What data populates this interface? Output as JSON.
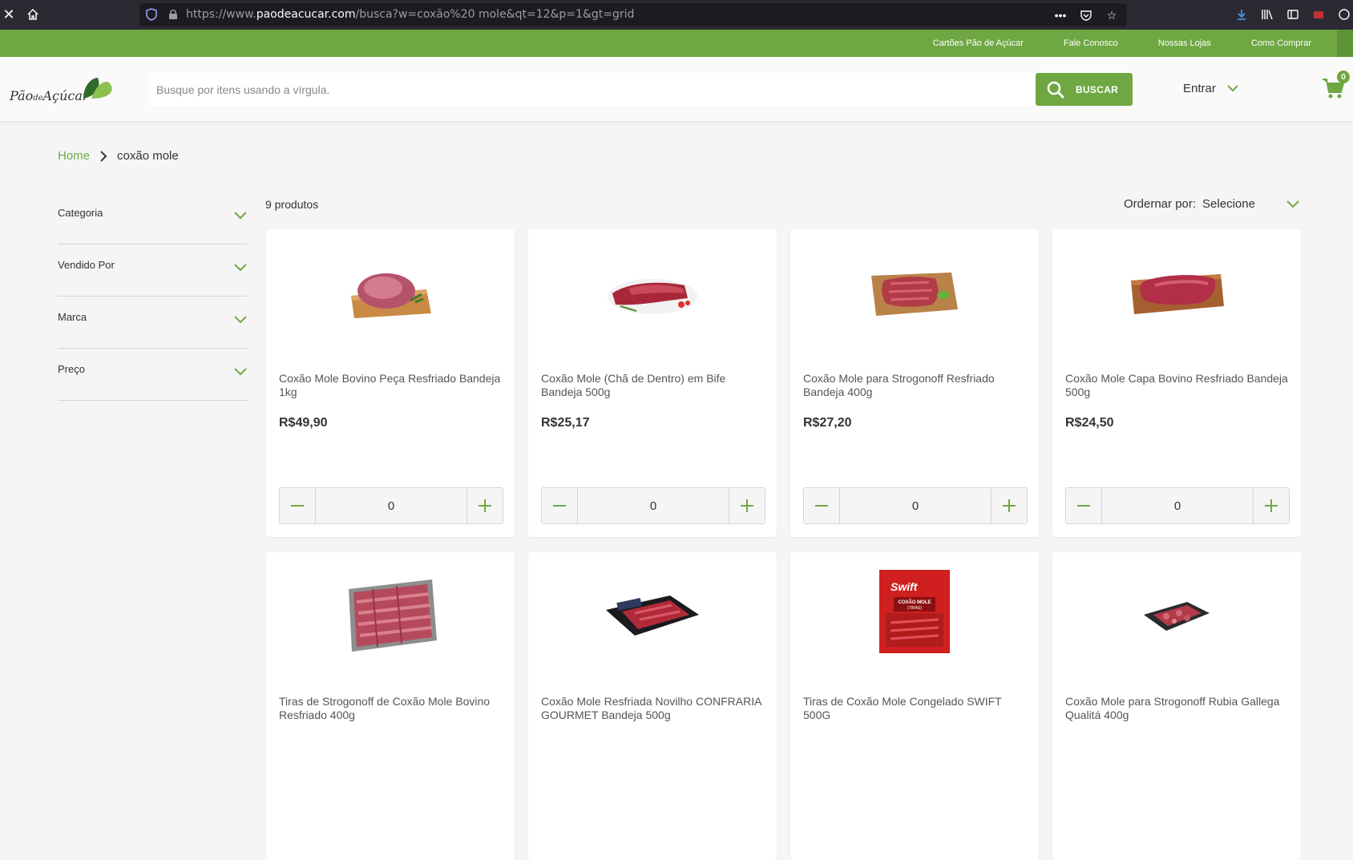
{
  "browser": {
    "url_prefix": "https://www.",
    "url_domain": "paodeacucar.com",
    "url_path": "/busca?w=coxão%20 mole&qt=12&p=1&gt=grid"
  },
  "topbar": {
    "links": [
      "Cartões Pão de Açúcar",
      "Fale Conosco",
      "Nossas Lojas",
      "Como Comprar"
    ]
  },
  "header": {
    "logo_main": "Pão",
    "logo_de": "de",
    "logo_end": "Açúcar",
    "search_placeholder": "Busque por itens usando a vírgula.",
    "search_button": "BUSCAR",
    "login_label": "Entrar",
    "cart_count": "0"
  },
  "breadcrumb": {
    "home": "Home",
    "current": "coxão mole"
  },
  "filters": [
    "Categoria",
    "Vendido Por",
    "Marca",
    "Preço"
  ],
  "results": {
    "count": "9 produtos",
    "sort_label": "Ordernar por:",
    "sort_value": "Selecione"
  },
  "products": [
    {
      "name": "Coxão Mole Bovino Peça Resfriado Bandeja 1kg",
      "price": "R$49,90",
      "qty": "0"
    },
    {
      "name": "Coxão Mole (Chã de Dentro) em Bife Bandeja 500g",
      "price": "R$25,17",
      "qty": "0"
    },
    {
      "name": "Coxão Mole para Strogonoff Resfriado Bandeja 400g",
      "price": "R$27,20",
      "qty": "0"
    },
    {
      "name": "Coxão Mole Capa Bovino Resfriado Bandeja 500g",
      "price": "R$24,50",
      "qty": "0"
    },
    {
      "name": "Tiras de Strogonoff de Coxão Mole Bovino Resfriado 400g",
      "price": "",
      "qty": ""
    },
    {
      "name": "Coxão Mole Resfriada Novilho CONFRARIA GOURMET Bandeja 500g",
      "price": "",
      "qty": ""
    },
    {
      "name": "Tiras de Coxão Mole Congelado SWIFT 500G",
      "price": "",
      "qty": ""
    },
    {
      "name": "Coxão Mole para Strogonoff Rubia Gallega Qualitá 400g",
      "price": "",
      "qty": ""
    }
  ],
  "package_labels": {
    "swift_brand": "Swift",
    "swift_product": "COXÃO MOLE",
    "swift_variant": "(TIRAS)"
  },
  "colors": {
    "brand_green": "#6fa843",
    "browser_dark": "#2b2a33"
  }
}
